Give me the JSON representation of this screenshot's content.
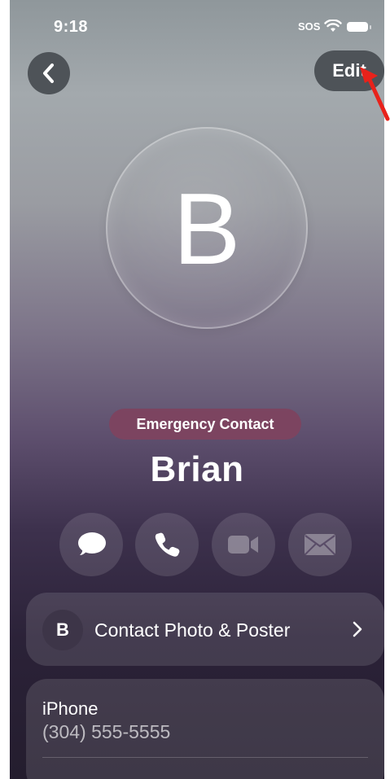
{
  "status_bar": {
    "time": "9:18",
    "carrier": "SOS"
  },
  "nav": {
    "edit_label": "Edit"
  },
  "contact": {
    "initial": "B",
    "badge": "Emergency Contact",
    "name": "Brian"
  },
  "actions": [
    {
      "icon": "message-icon"
    },
    {
      "icon": "phone-icon"
    },
    {
      "icon": "video-icon"
    },
    {
      "icon": "mail-icon"
    }
  ],
  "poster_row": {
    "initial": "B",
    "label": "Contact Photo & Poster"
  },
  "phone": {
    "label": "iPhone",
    "number": "(304) 555-5555"
  },
  "colors": {
    "badge": "#7c4460",
    "button_bg": "#4e5358",
    "annotation_arrow": "#e8221b"
  }
}
